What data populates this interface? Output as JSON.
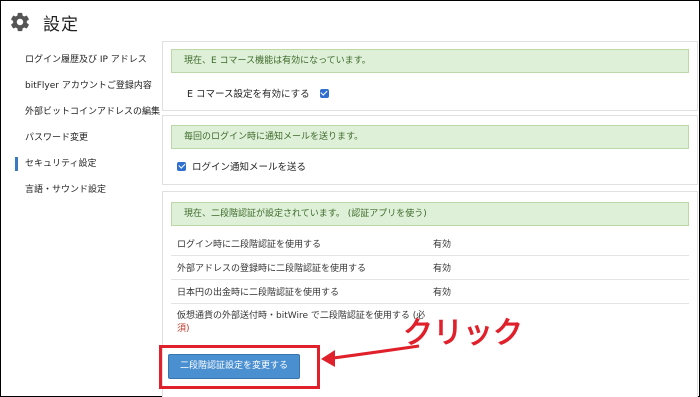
{
  "header": {
    "title": "設定",
    "icon": "gear-icon"
  },
  "sidebar": {
    "items": [
      {
        "label": "ログイン履歴及び IP アドレス",
        "active": false
      },
      {
        "label": "bitFlyer アカウントご登録内容",
        "active": false
      },
      {
        "label": "外部ビットコインアドレスの編集",
        "active": false
      },
      {
        "label": "パスワード変更",
        "active": false
      },
      {
        "label": "セキュリティ設定",
        "active": true
      },
      {
        "label": "言語・サウンド設定",
        "active": false
      }
    ]
  },
  "ecommerce": {
    "alert": "現在、E コマース機能は有効になっています。",
    "checkbox_label": "E コマース設定を有効にする",
    "checked": true
  },
  "login_notify": {
    "alert": "毎回のログイン時に通知メールを送ります。",
    "checkbox_label": "ログイン通知メールを送る",
    "checked": true
  },
  "two_factor": {
    "alert": "現在、二段階認証が設定されています。 (認証アプリを使う)",
    "rows": [
      {
        "label": "ログイン時に二段階認証を使用する",
        "value": "有効"
      },
      {
        "label": "外部アドレスの登録時に二段階認証を使用する",
        "value": "有効"
      },
      {
        "label": "日本円の出金時に二段階認証を使用する",
        "value": "有効"
      },
      {
        "label": "仮想通貨の外部送付時・bitWire で二段階認証を使用する (必",
        "required": "須)"
      }
    ],
    "change_button": "二段階認証設定を変更する"
  },
  "annotation": {
    "text": "クリック",
    "color": "#e0202a"
  }
}
